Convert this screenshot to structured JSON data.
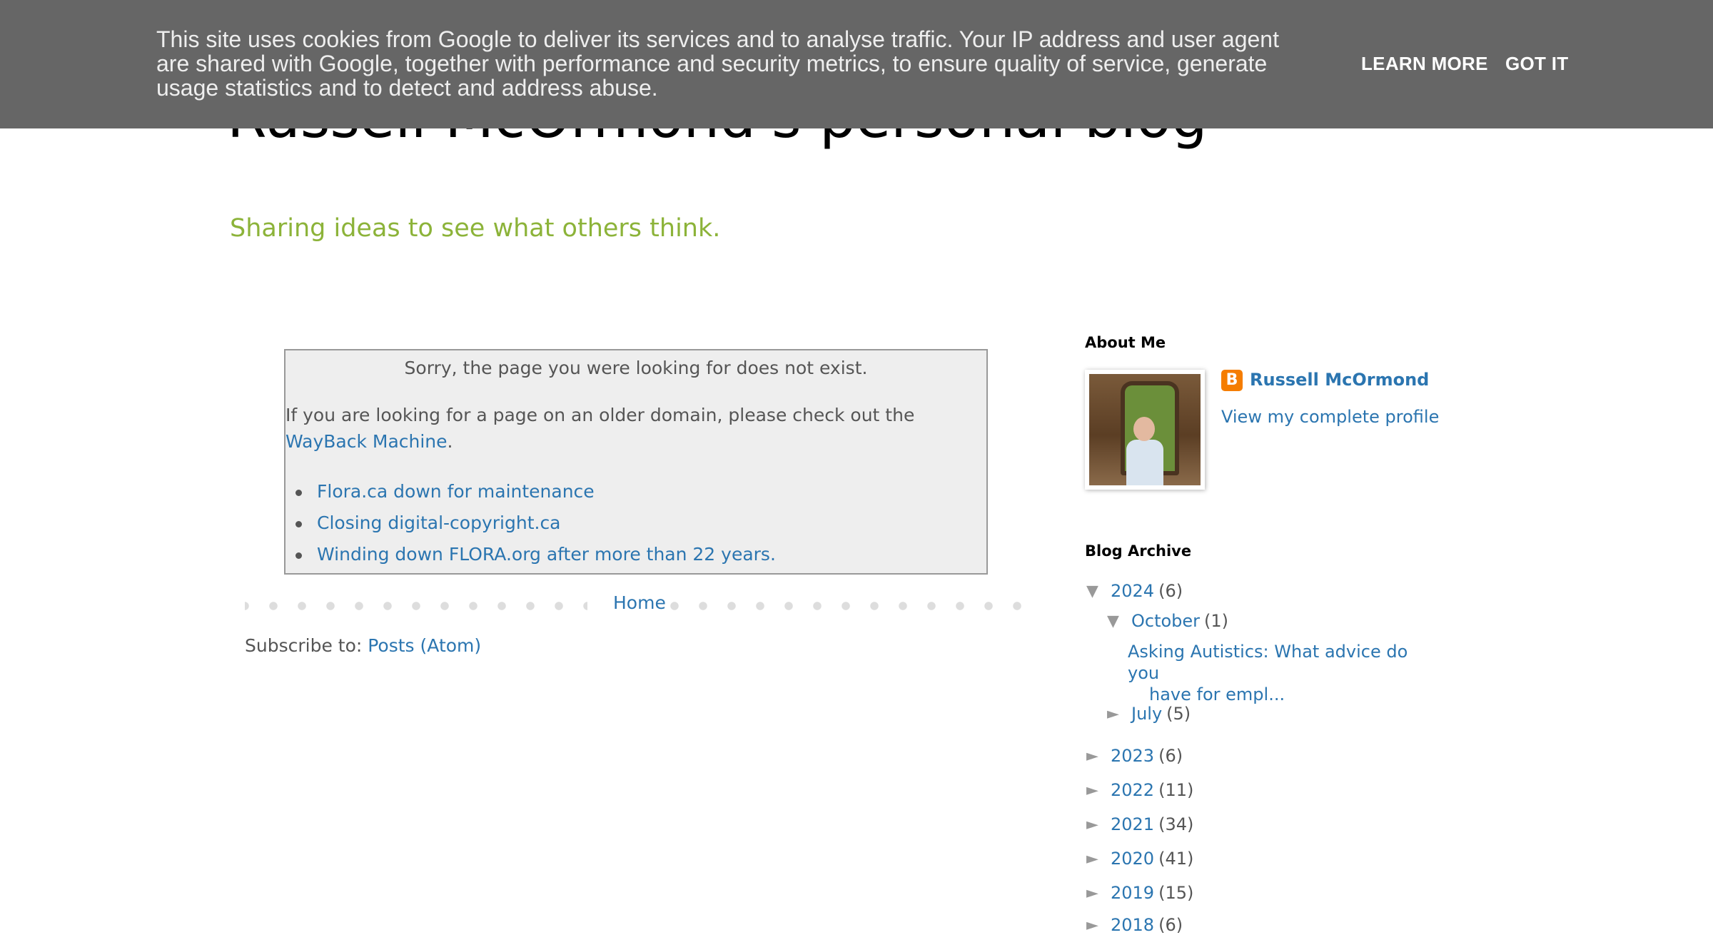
{
  "header": {
    "title": "Russell McOrmond's personal blog",
    "description": "Sharing ideas to see what others think."
  },
  "cookie_banner": {
    "text": "This site uses cookies from Google to deliver its services and to analyse traffic. Your IP address and user agent are shared with Google, together with performance and security metrics, to ensure quality of service, generate usage statistics and to detect and address abuse.",
    "learn_more": "LEARN MORE",
    "got_it": "GOT IT"
  },
  "error": {
    "message": "Sorry, the page you were looking for does not exist.",
    "older_domain_text": "If you are looking for a page on an older domain, please check out the ",
    "wayback_link": "WayBack Machine",
    "period": ".",
    "links": [
      "Flora.ca down for maintenance",
      "Closing digital-copyright.ca",
      "Winding down FLORA.org after more than 22 years."
    ]
  },
  "pager": {
    "home": "Home"
  },
  "subscribe": {
    "label": "Subscribe to: ",
    "link": "Posts (Atom)"
  },
  "sidebar": {
    "about_heading": "About Me",
    "profile_name": "Russell McOrmond",
    "profile_view": "View my complete profile",
    "archive_heading": "Blog Archive",
    "archive": {
      "y2024": {
        "label": "2024",
        "count": "(6)",
        "toggle": "▼"
      },
      "october": {
        "label": "October",
        "count": "(1)",
        "toggle": "▼"
      },
      "post": {
        "line1": "Asking Autistics: What advice do you",
        "line2": "have for empl..."
      },
      "july": {
        "label": "July",
        "count": "(5)",
        "toggle": "►"
      },
      "years": [
        {
          "label": "2023",
          "count": "(6)",
          "toggle": "►"
        },
        {
          "label": "2022",
          "count": "(11)",
          "toggle": "►"
        },
        {
          "label": "2021",
          "count": "(34)",
          "toggle": "►"
        },
        {
          "label": "2020",
          "count": "(41)",
          "toggle": "►"
        },
        {
          "label": "2019",
          "count": "(15)",
          "toggle": "►"
        },
        {
          "label": "2018",
          "count": "(6)",
          "toggle": "►"
        }
      ]
    }
  },
  "colors": {
    "link": "#2b75b0",
    "description": "#8cb339",
    "cookie_bg": "#666666",
    "box_bg": "#eeeeee",
    "blogger_icon": "#f57d00"
  },
  "icons": [
    "blogger-icon",
    "collapse-arrow-icon",
    "expand-arrow-icon"
  ]
}
